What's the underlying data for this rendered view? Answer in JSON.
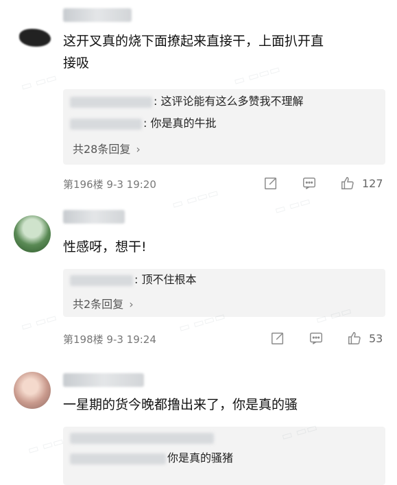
{
  "comments": [
    {
      "text_line1": "这开叉真的烧下面撩起来直接干，上面扒开直",
      "text_line2": "接吸",
      "replies": [
        {
          "text": ": 这评论能有这么多赞我不理解"
        },
        {
          "text": ": 你是真的牛批"
        }
      ],
      "more_replies": "共28条回复",
      "floor_time": "第196楼 9-3 19:20",
      "likes": "127"
    },
    {
      "text_line1": "性感呀，想干!",
      "replies": [
        {
          "text": ": 顶不住根本"
        }
      ],
      "more_replies": "共2条回复",
      "floor_time": "第198楼 9-3 19:24",
      "likes": "53"
    },
    {
      "text_line1": "一星期的货今晚都撸出来了，你是真的骚",
      "replies": [
        {
          "text": "你是真的骚猪"
        }
      ]
    }
  ],
  "icons": {
    "edit": "edit-icon",
    "comment": "comment-icon",
    "like": "thumbs-up-icon",
    "chevron": "chevron-right-icon"
  },
  "colors": {
    "reply_bg": "#f3f3f3",
    "meta_text": "#777777",
    "icon": "#8a8a8a"
  }
}
